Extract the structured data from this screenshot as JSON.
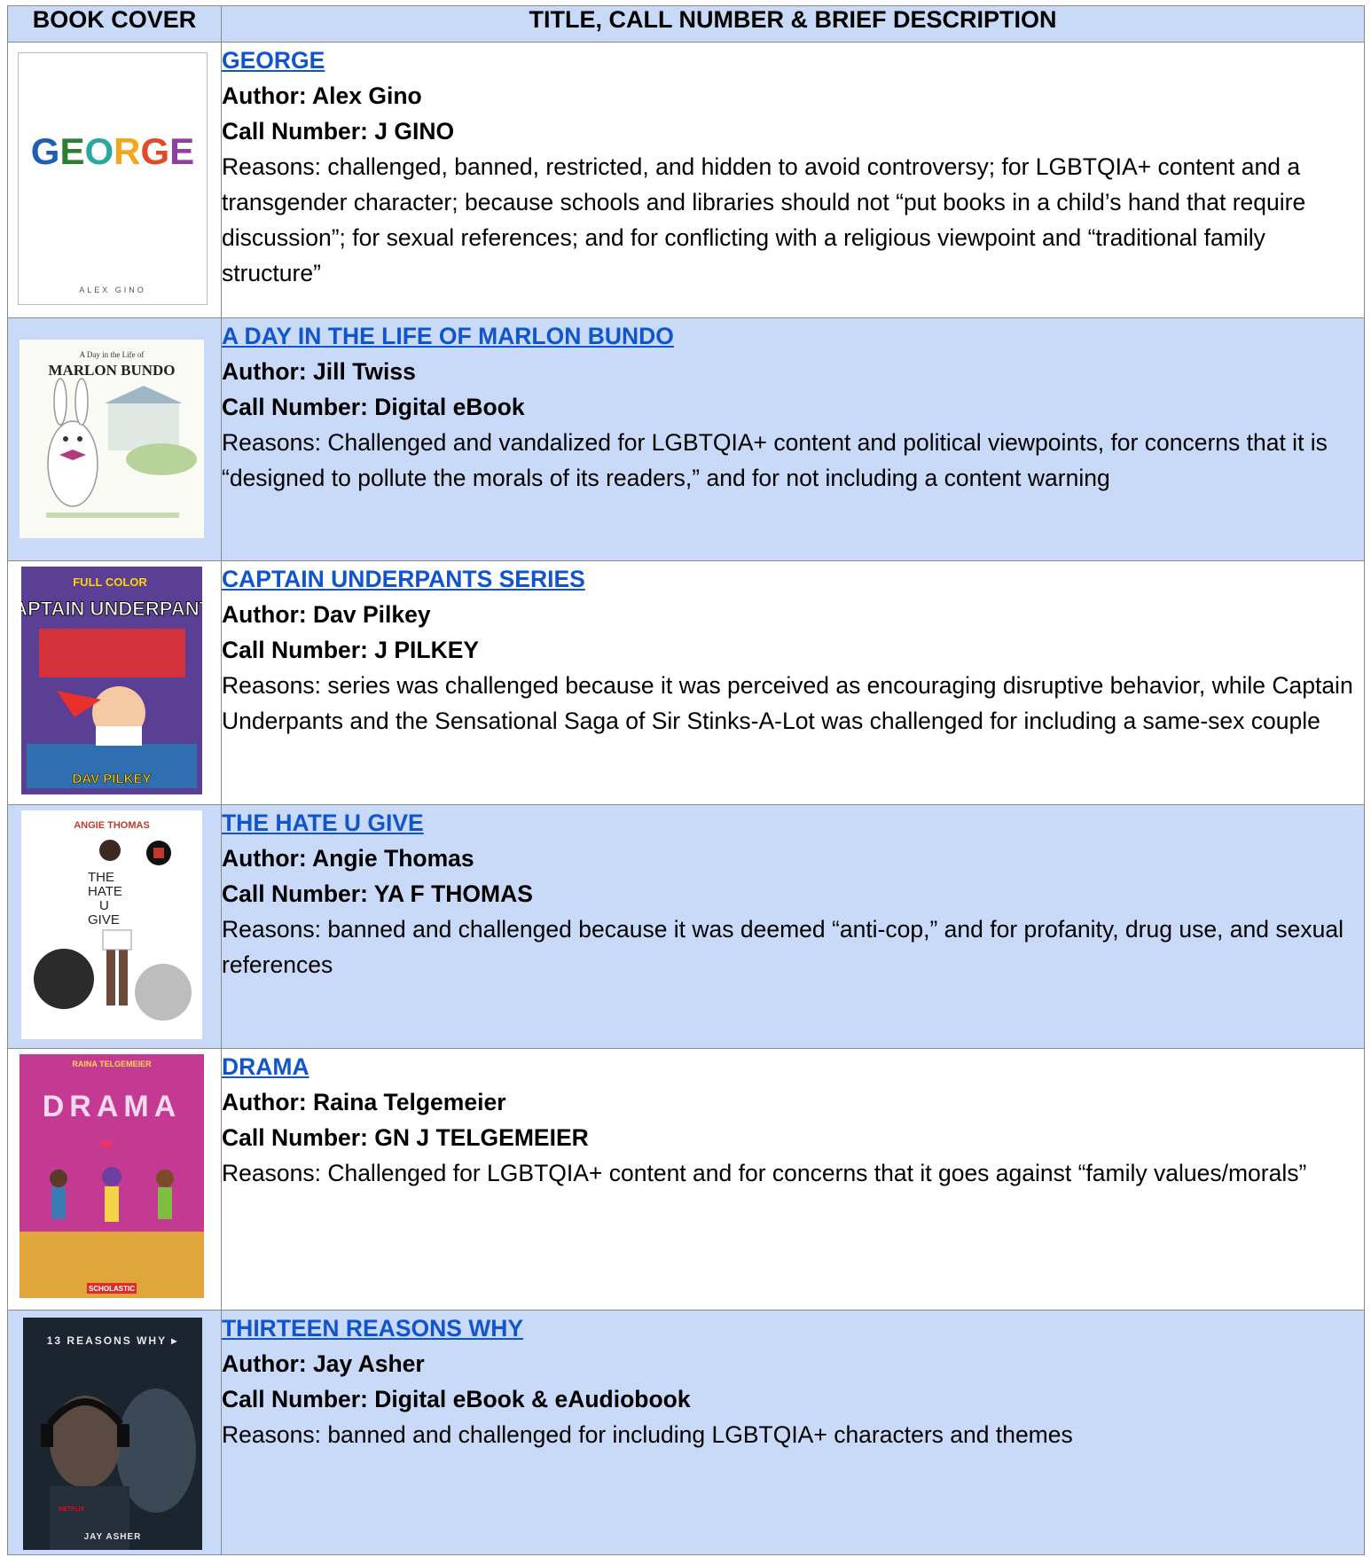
{
  "header": {
    "col1": "BOOK COVER",
    "col2": "TITLE, CALL NUMBER & BRIEF DESCRIPTION"
  },
  "books": [
    {
      "title": "GEORGE",
      "author": "Author: Alex Gino",
      "call_number": "Call Number: J GINO",
      "reasons": "Reasons: challenged, banned, restricted, and hidden to avoid controversy; for LGBTQIA+ content and a transgender character; because schools and libraries should not “put books in a child’s hand that require discussion”; for sexual references; and for conflicting with a religious viewpoint and “traditional family structure”",
      "cover": {
        "title_text": "GEORGE",
        "author_text": "ALEX GINO"
      }
    },
    {
      "title": "A DAY IN THE LIFE OF MARLON BUNDO",
      "author": "Author: Jill Twiss",
      "call_number": "Call Number: Digital eBook",
      "reasons": "Reasons: Challenged and vandalized for LGBTQIA+ content and political viewpoints, for concerns that it is “designed to pollute the morals of its readers,” and for not including a content warning",
      "cover": {
        "small_text": "A Day in the Life of",
        "title_text": "MARLON BUNDO"
      }
    },
    {
      "title": "CAPTAIN UNDERPANTS SERIES",
      "author": "Author: Dav Pilkey",
      "call_number": "Call Number: J PILKEY",
      "reasons": "Reasons: series was challenged because it was perceived as encouraging disruptive behavior, while Captain Underpants and the Sensational Saga of Sir Stinks-A-Lot was challenged for including a same-sex couple",
      "cover": {
        "banner_text": "FULL COLOR",
        "title_text": "CAPTAIN UNDERPANTS",
        "author_text": "DAV PILKEY"
      }
    },
    {
      "title": "THE HATE U GIVE",
      "author": "Author: Angie Thomas",
      "call_number": "Call Number: YA F THOMAS",
      "reasons": "Reasons: banned and challenged because it was deemed “anti-cop,” and for profanity, drug use, and sexual references",
      "cover": {
        "author_text": "ANGIE THOMAS",
        "title_lines": [
          "THE",
          "HATE",
          "U",
          "GIVE"
        ]
      }
    },
    {
      "title": "DRAMA",
      "author": "Author: Raina Telgemeier",
      "call_number": "Call Number: GN J TELGEMEIER",
      "reasons": "Reasons: Challenged for LGBTQIA+ content and for concerns that it goes against “family values/morals”",
      "cover": {
        "author_text": "RAINA TELGEMEIER",
        "title_text": "DRAMA",
        "publisher_text": "SCHOLASTIC"
      }
    },
    {
      "title": "THIRTEEN REASONS WHY",
      "author": "Author: Jay Asher",
      "call_number": "Call Number: Digital eBook & eAudiobook",
      "reasons": "Reasons: banned and challenged for including LGBTQIA+ characters and themes",
      "cover": {
        "title_text": "13 REASONS WHY ▸",
        "author_text": "JAY ASHER",
        "brand_text": "NETFLIX"
      }
    }
  ]
}
